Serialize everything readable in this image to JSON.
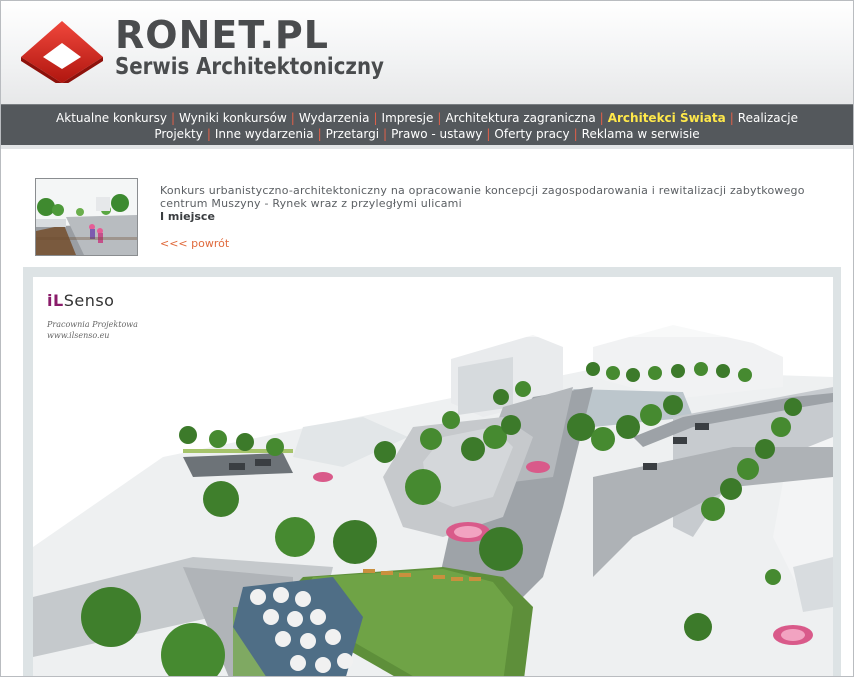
{
  "site": {
    "name": "RONET.PL",
    "subtitle": "Serwis Architektoniczny"
  },
  "nav": {
    "row1": [
      "Aktualne konkursy",
      "Wyniki konkursów",
      "Wydarzenia",
      "Impresje",
      "Architektura zagraniczna",
      "Architekci Świata",
      "Realizacje"
    ],
    "row2": [
      "Projekty",
      "Inne wydarzenia",
      "Przetargi",
      "Prawo - ustawy",
      "Oferty pracy",
      "Reklama w serwisie"
    ],
    "highlight": "Architekci Świata",
    "separator": "|"
  },
  "article": {
    "description": "Konkurs urbanistyczno-architektoniczny na opracowanie koncepcji zagospodarowania i rewitalizacji zabytkowego centrum Muszyny - Rynek wraz z przyległymi ulicami",
    "place": "I miejsce",
    "back_link": "<<< powrót"
  },
  "image": {
    "brand_prefix": "iL",
    "brand_name": "Senso",
    "brand_line1": "Pracownia Projektowa",
    "brand_line2": "www.ilsenso.eu"
  },
  "colors": {
    "nav_bg": "#54585c",
    "nav_highlight": "#ffe84a",
    "separator": "#e0604a",
    "logo_red": "#d42a22",
    "link": "#e06a3c"
  }
}
